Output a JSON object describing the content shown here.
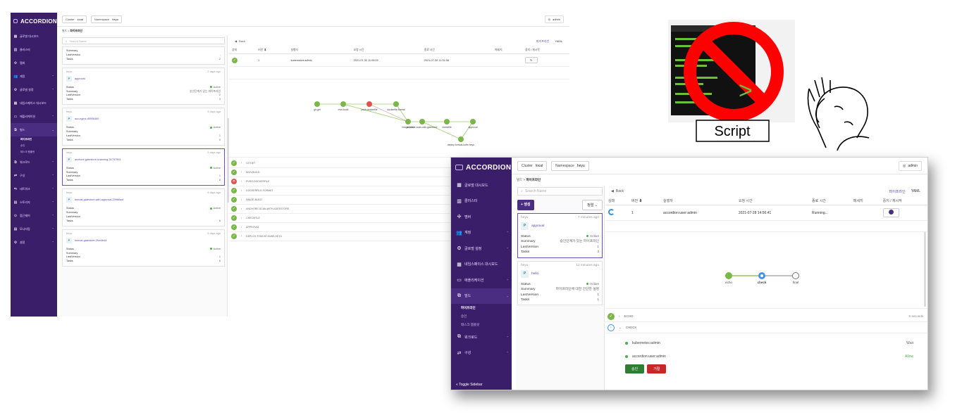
{
  "brand": "ACCORDION",
  "cluster": {
    "label": "Cluster",
    "value": "local"
  },
  "namespace": {
    "label": "Namespace",
    "value": "heyu"
  },
  "user": "admin",
  "breadcrumb": {
    "parent": "빌드",
    "sep": ">",
    "current": "파이프라인"
  },
  "back": "Back",
  "tabs": {
    "pipeline": "파이프라인",
    "yaml": "YAML"
  },
  "search_placeholder": "Search Name",
  "create_btn": "+ 생성",
  "sort_btn": "정렬",
  "toggle_sidebar": "Toggle Sidebar",
  "sidebar1": [
    {
      "icon": "▦",
      "label": "글로벌 대시보드",
      "chev": ""
    },
    {
      "icon": "▥",
      "label": "클러스터",
      "chev": ""
    },
    {
      "icon": "✣",
      "label": "멤버",
      "chev": ""
    },
    {
      "icon": "👥",
      "label": "계정",
      "chev": "⌃"
    },
    {
      "icon": "⚙",
      "label": "글로벌 설정",
      "chev": "⌃"
    },
    {
      "icon": "▦",
      "label": "네임스페이스 대시보드",
      "chev": ""
    },
    {
      "icon": "▭",
      "label": "애플리케이션",
      "chev": "⌃"
    },
    {
      "icon": "⧉",
      "label": "빌드",
      "chev": "⌄"
    }
  ],
  "sidebar1_sub": [
    "파이프라인",
    "승인",
    "태스크 템플릿"
  ],
  "sidebar1_after": [
    {
      "icon": "⧉",
      "label": "워크로드",
      "chev": "⌃"
    },
    {
      "icon": "⇄",
      "label": "구성",
      "chev": "⌃"
    },
    {
      "icon": "⇋",
      "label": "네트워크",
      "chev": "⌃"
    },
    {
      "icon": "▤",
      "label": "스토리지",
      "chev": "⌃"
    },
    {
      "icon": "⊙",
      "label": "접근제어",
      "chev": "⌃"
    },
    {
      "icon": "▤",
      "label": "모니터링",
      "chev": "⌃"
    },
    {
      "icon": "⚙",
      "label": "설정",
      "chev": "⌃"
    }
  ],
  "ss1_cards": [
    {
      "ns": "",
      "age": "",
      "name": "",
      "status": "",
      "summary": "",
      "lastversion": "-",
      "tasks": "2",
      "partial": true
    },
    {
      "ns": "heyu",
      "age": "2 days ago",
      "name": "approval",
      "status": "Active",
      "summary": "승인단계가 있는 파이프라인",
      "lastversion": "2",
      "tasks": "3"
    },
    {
      "ns": "heyu",
      "age": "5 days ago",
      "name": "acc-nginx-d5906490",
      "status": "Active",
      "summary": "",
      "lastversion": "1",
      "tasks": "0"
    },
    {
      "ns": "heyu",
      "age": "5 days ago",
      "name": "anchore-gatestore-scanning-31797991",
      "status": "Active",
      "summary": "",
      "lastversion": "1",
      "tasks": "8",
      "selected": true
    },
    {
      "ns": "heyu",
      "age": "6 days ago",
      "name": "tomcat-gatestore-with-approval-20966acf",
      "status": "Active",
      "summary": "",
      "lastversion": "",
      "tasks": "6"
    },
    {
      "ns": "heyu",
      "age": "6 days ago",
      "name": "tomcat-gatestore-2fce4b4d",
      "status": "Active",
      "summary": "",
      "lastversion": "1",
      "tasks": "6"
    }
  ],
  "labels": {
    "status": "Status",
    "summary": "Summary",
    "lastversion": "LastVersion",
    "tasks": "Tasks"
  },
  "runs_headers": [
    "상태",
    "버전 ⬇",
    "실행자",
    "요청 시간",
    "종료 시간",
    "메세지",
    "중지 / 재시작"
  ],
  "ss1_run": {
    "version": "1",
    "executor": "kubernetes:admin",
    "requested": "2021-07-30 11:09:09",
    "finished": "2021-07-30 11:31:56",
    "message": "",
    "action": "↻"
  },
  "ss1_graph_nodes": [
    {
      "label": "git-get",
      "state": "ok"
    },
    {
      "label": "mvn-build",
      "state": "ok"
    },
    {
      "label": "push-dockerfile",
      "state": "fail"
    },
    {
      "label": "dockerfile-format",
      "state": "ok"
    },
    {
      "label": "image-build",
      "state": "ok"
    },
    {
      "label": "anchore-scan-with-gatestore",
      "state": "ok"
    },
    {
      "label": "checkfile",
      "state": "ok"
    },
    {
      "label": "approval",
      "state": "ok"
    },
    {
      "label": "deploy-tomcat-kube-heyu",
      "state": "ok"
    }
  ],
  "ss1_steps": [
    {
      "state": "ok",
      "label": "GITGET",
      "dur": "6 seconds"
    },
    {
      "state": "ok",
      "label": "MVN-BUILD",
      "dur": ""
    },
    {
      "state": "fail",
      "label": "PUSH-DOCKERFILE",
      "dur": ""
    },
    {
      "state": "ok",
      "label": "DOCKERFILE-FORMAT",
      "dur": ""
    },
    {
      "state": "ok",
      "label": "IMAGE-BUILD",
      "dur": ""
    },
    {
      "state": "ok",
      "label": "ANCHORE-SCAN-WITH-GATESTORE",
      "dur": ""
    },
    {
      "state": "ok",
      "label": "CHECKFILE",
      "dur": ""
    },
    {
      "state": "ok",
      "label": "APPROVAL",
      "dur": ""
    },
    {
      "state": "ok",
      "label": "DEPLOY-TOMCAT-KUBE-HEYU",
      "dur": ""
    }
  ],
  "sidebar2": [
    {
      "icon": "▦",
      "label": "글로벌 대시보드",
      "chev": ""
    },
    {
      "icon": "▥",
      "label": "클러스터",
      "chev": ""
    },
    {
      "icon": "✣",
      "label": "멤버",
      "chev": ""
    },
    {
      "icon": "👥",
      "label": "계정",
      "chev": "⌃"
    },
    {
      "icon": "⚙",
      "label": "글로벌 설정",
      "chev": "⌃"
    },
    {
      "icon": "▦",
      "label": "네임스페이스 대시보드",
      "chev": ""
    },
    {
      "icon": "▭",
      "label": "애플리케이션",
      "chev": "⌃"
    },
    {
      "icon": "⧉",
      "label": "빌드",
      "chev": "⌄"
    }
  ],
  "sidebar2_sub": [
    "파이프라인",
    "승인",
    "태스크 템플릿"
  ],
  "sidebar2_after": [
    {
      "icon": "⧉",
      "label": "워크로드",
      "chev": "⌃"
    },
    {
      "icon": "⇄",
      "label": "구성",
      "chev": "⌃"
    }
  ],
  "ss2_cards": [
    {
      "ns": "heyu",
      "age": "7 minutes ago",
      "name": "approval",
      "status": "Active",
      "summary": "승인단계가 있는 파이프라인",
      "lastversion": "1",
      "tasks": "3",
      "selected": true
    },
    {
      "ns": "heyu",
      "age": "12 minutes ago",
      "name": "hello",
      "status": "Active",
      "summary": "파이프라인에 대한 간단한 설명",
      "lastversion": "1",
      "tasks": "1"
    }
  ],
  "ss2_run": {
    "version": "1",
    "executor": "accordion:user:admin",
    "requested": "2021-07-28 14:56:41",
    "finished": "Running...",
    "message": ""
  },
  "ss2_graph_nodes": [
    {
      "label": "echo",
      "state": "ok"
    },
    {
      "label": "check",
      "state": "active"
    },
    {
      "label": "final",
      "state": "pending"
    }
  ],
  "ss2_steps": [
    {
      "state": "ok",
      "label": "ECHO",
      "dur": "5 seconds"
    },
    {
      "state": "todo",
      "label": "CHECK",
      "dur": ""
    }
  ],
  "approvals": [
    {
      "user": "kubernetes:admin",
      "status": "Wait",
      "color": "#666666"
    },
    {
      "user": "accordion:user:admin",
      "status": "Allow",
      "color": "#4caf50"
    }
  ],
  "approve_btn": "승인",
  "reject_btn": "거절",
  "script_label": "Script",
  "colors": {
    "sidebar": "#3a1e6a",
    "accent": "#5a47b0",
    "ok": "#7ab648",
    "fail": "#e05252",
    "prohibit": "#ff0000"
  }
}
